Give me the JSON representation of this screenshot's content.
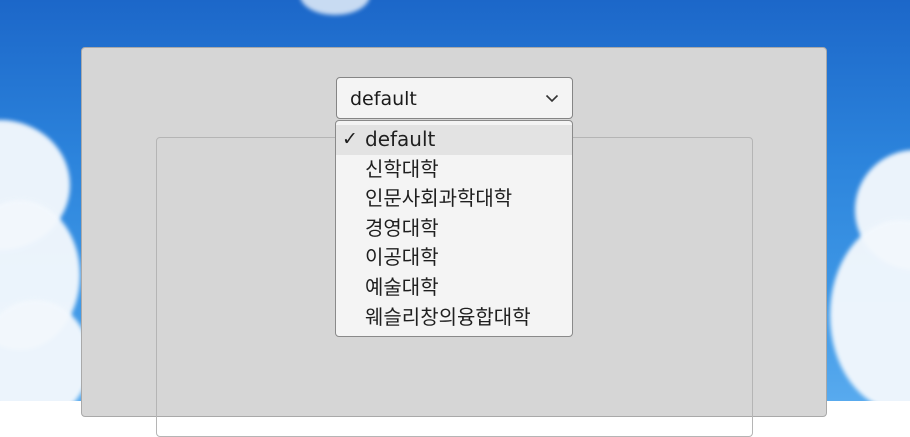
{
  "dropdown": {
    "selected_value": "default",
    "options": [
      {
        "label": "default",
        "selected": true
      },
      {
        "label": "신학대학",
        "selected": false
      },
      {
        "label": "인문사회과학대학",
        "selected": false
      },
      {
        "label": "경영대학",
        "selected": false
      },
      {
        "label": "이공대학",
        "selected": false
      },
      {
        "label": "예술대학",
        "selected": false
      },
      {
        "label": "웨슬리창의융합대학",
        "selected": false
      }
    ]
  },
  "icons": {
    "arrow": "chevron-down-icon",
    "check": "checkmark-icon"
  },
  "colors": {
    "sky": "#2c84dc",
    "panel": "#d6d6d6",
    "control": "#f4f4f4",
    "selected_row": "#e3e3e3"
  }
}
